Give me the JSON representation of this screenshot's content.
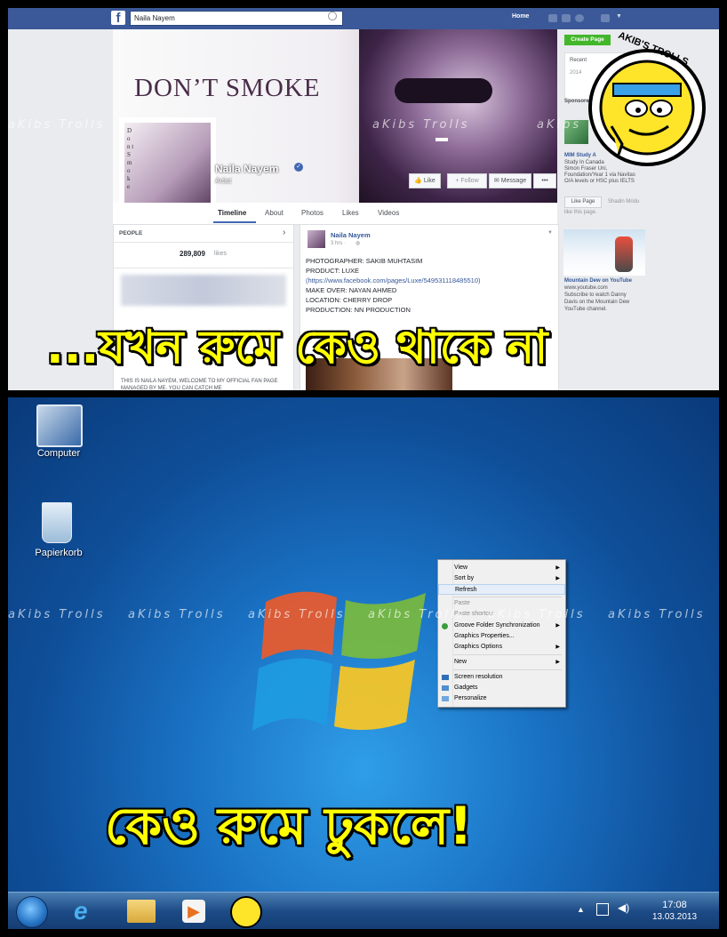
{
  "facebook": {
    "search_value": "Naila Nayem",
    "home_label": "Home",
    "cover_title": "DON’T SMOKE",
    "profile_pic_text": "D o n t S m o k e",
    "page_name": "Naila Nayem",
    "category": "Artist",
    "buttons": {
      "like": "Like",
      "follow": "Follow",
      "message": "Message",
      "more": "•••"
    },
    "tabs": [
      "Timeline",
      "About",
      "Photos",
      "Likes",
      "Videos"
    ],
    "people": {
      "header": "PEOPLE",
      "likes_count": "289,809",
      "likes_label": "likes",
      "about": "THIS IS NAILA NAYEM, WELCOME TO MY OFFICIAL FAN PAGE MANAGED BY ME. YOU CAN CATCH ME"
    },
    "post": {
      "author": "Naila Nayem",
      "time": "3 hrs · ",
      "lines": [
        "PHOTOGRAPHER: SAKIB MUHTASIM",
        "PRODUCT: LUXE",
        "(https://www.facebook.com/pages/Luxe/549531118485510)",
        "MAKE OVER: NAYAN AHMED",
        "LOCATION: CHERRY DROP",
        "PRODUCTION: NN PRODUCTION"
      ]
    },
    "right": {
      "create_page": "Create Page",
      "recent": "Recent",
      "year": "2014",
      "sponsored": "Sponsored",
      "ad1_title": "MIM Study A",
      "ad1_text": [
        "Study In Canada",
        "Simon Fraser Uni, ",
        "Foundation/Year 1 via Navitas",
        "O/A levels or HSC plus IELTS"
      ],
      "like_page": "Like Page",
      "shadin": "Shadin Mridu",
      "like_this": "like this page.",
      "ad2_title": "Mountain Dew on YouTube",
      "ad2_url": "www.youtube.com",
      "ad2_text": [
        "Subscribe to watch Danny",
        "Davis on the Mountain Dew",
        "YouTube channel."
      ]
    }
  },
  "watermark": "aKibs Trolls",
  "logo_text": "AKIB'S TROLLS",
  "caption_top": "...যখন রুমে কেও থাকে না",
  "caption_bottom": "কেও রুমে ঢুকলে!",
  "desktop": {
    "icons": [
      {
        "label": "Computer"
      },
      {
        "label": "Papierkorb"
      }
    ],
    "context_menu": [
      {
        "label": "View",
        "arrow": "▶"
      },
      {
        "label": "Sort by",
        "arrow": "▶"
      },
      {
        "label": "Refresh"
      },
      {
        "label": "Paste"
      },
      {
        "label": "Paste shortcut"
      },
      {
        "label": "Groove Folder Synchronization",
        "arrow": "▶"
      },
      {
        "label": "Graphics Properties..."
      },
      {
        "label": "Graphics Options",
        "arrow": "▶"
      },
      {
        "label": "New",
        "arrow": "▶"
      },
      {
        "label": "Screen resolution"
      },
      {
        "label": "Gadgets"
      },
      {
        "label": "Personalize"
      }
    ],
    "clock": {
      "time": "17:08",
      "date": "13.03.2013"
    }
  }
}
